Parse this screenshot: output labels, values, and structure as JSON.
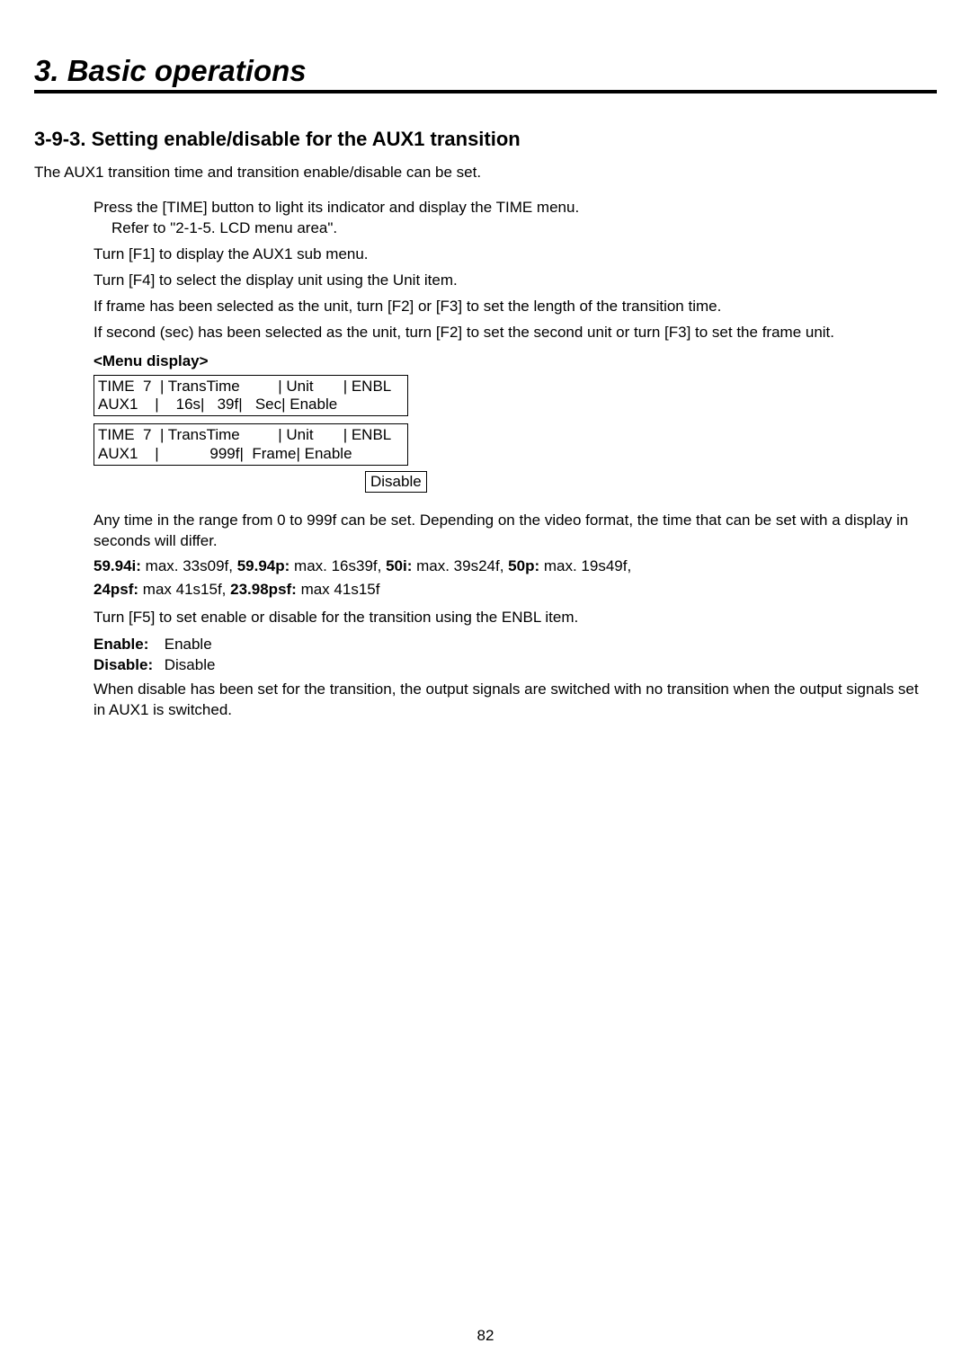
{
  "chapter": "3. Basic operations",
  "section": "3-9-3.  Setting enable/disable for the AUX1 transition",
  "intro": "The AUX1 transition time and transition enable/disable can be set.",
  "steps": {
    "s1a": "Press the [TIME] button to light its indicator and display the TIME menu.",
    "s1b": "Refer to \"2-1-5. LCD menu area\".",
    "s2": "Turn [F1] to display the AUX1 sub menu.",
    "s3": "Turn [F4] to select the display unit using the Unit item.",
    "s4": "If frame has been selected as the unit, turn [F2] or [F3] to set the length of the transition time.",
    "s5": "If second (sec) has been selected as the unit, turn [F2] to set the second unit or turn [F3] to set the frame unit."
  },
  "menuDisplayLabel": "<Menu display>",
  "menuBox1": "TIME  7  | TransTime         | Unit       | ENBL\nAUX1    |    16s|   39f|   Sec| Enable",
  "menuBox2": "TIME  7  | TransTime         | Unit       | ENBL\nAUX1    |            999f|  Frame| Enable",
  "disableLabel": "Disable",
  "rangeText": "Any time in the range from 0 to 999f can be set. Depending on the video format, the time that can be set with a display in seconds will differ.",
  "formats": {
    "l1_b1": "59.94i:",
    "l1_t1": " max. 33s09f,  ",
    "l1_b2": "59.94p:",
    "l1_t2": " max. 16s39f,  ",
    "l1_b3": "50i:",
    "l1_t3": " max. 39s24f,  ",
    "l1_b4": "50p:",
    "l1_t4": " max. 19s49f,",
    "l2_b1": "24psf:",
    "l2_t1": " max 41s15f,   ",
    "l2_b2": "23.98psf:",
    "l2_t2": " max 41s15f"
  },
  "enblStep": "Turn [F5] to set enable or disable for the transition using the ENBL item.",
  "enableLabel": "Enable:",
  "enableValue": "Enable",
  "disableLabel2": "Disable:",
  "disableValue": "Disable",
  "closing": "When disable has been set for the transition, the output signals are switched with no transition when the output signals set in AUX1 is switched.",
  "pageNum": "82"
}
